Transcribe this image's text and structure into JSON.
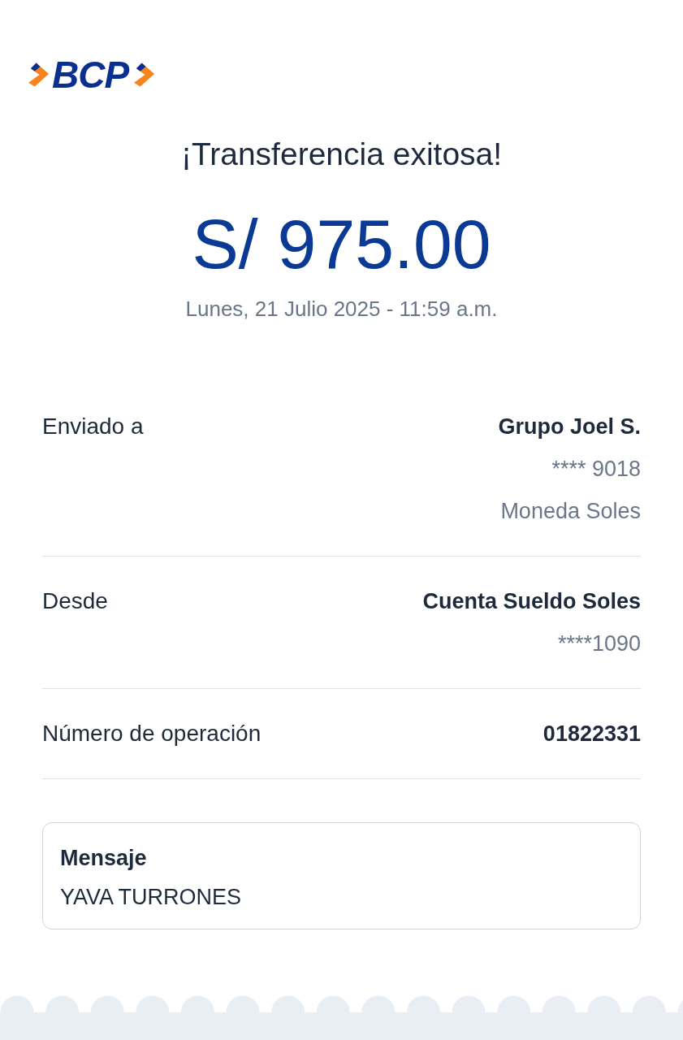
{
  "logo": {
    "text": "BCP"
  },
  "header": {
    "title": "¡Transferencia exitosa!",
    "amount": "S/ 975.00",
    "datetime": "Lunes, 21 Julio 2025 - 11:59 a.m."
  },
  "details": [
    {
      "label": "Enviado a",
      "values": [
        {
          "kind": "primary",
          "text": "Grupo Joel S."
        },
        {
          "kind": "secondary",
          "text": "**** 9018"
        },
        {
          "kind": "secondary",
          "text": "Moneda Soles"
        }
      ]
    },
    {
      "label": "Desde",
      "values": [
        {
          "kind": "primary",
          "text": "Cuenta Sueldo Soles"
        },
        {
          "kind": "secondary",
          "text": "****1090"
        }
      ]
    },
    {
      "label": "Número de operación",
      "values": [
        {
          "kind": "primary",
          "text": "01822331"
        }
      ]
    }
  ],
  "message": {
    "label": "Mensaje",
    "text": "YAVA TURRONES"
  }
}
